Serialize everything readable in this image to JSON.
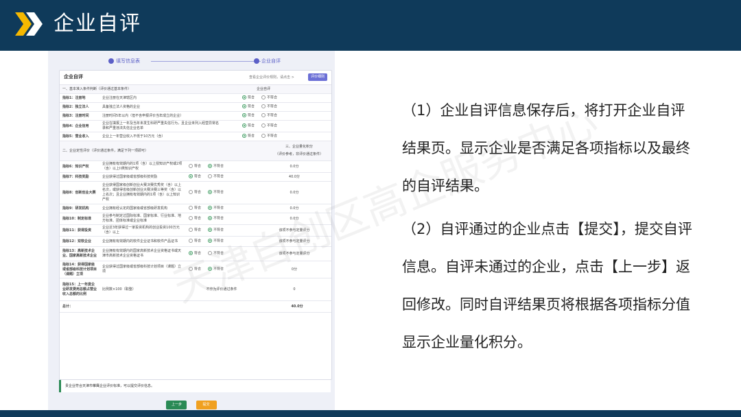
{
  "header": {
    "title": "企业自评"
  },
  "stepper": {
    "step1": "填写信息表",
    "step2": "企业自评"
  },
  "card": {
    "title": "企业自评",
    "search_placeholder": "查看企业评价规则，请点击 >",
    "rule_button": "评价细则"
  },
  "section1": {
    "title": "一、基本准入条件判断（评价通过基本条件）",
    "col_header": "企业自评"
  },
  "basic_rows": [
    {
      "name": "指标1：注册地",
      "desc": "企业注册在天津辖区内",
      "opt_yes": "符合",
      "opt_no": "不符合"
    },
    {
      "name": "指标2：独立法人",
      "desc": "具备独立法人资格的企业",
      "opt_yes": "符合",
      "opt_no": "不符合"
    },
    {
      "name": "指标3：注册时间",
      "desc": "注册时间5年以内（但不含申报评价当年成立的企业）",
      "opt_yes": "符合",
      "opt_no": "不符合"
    },
    {
      "name": "指标4：企业信用",
      "desc": "企业在填报上一年及当年未发生科研严重失信行为，且企业未列入经营异常名录和严重违法失信企业名单",
      "opt_yes": "符合",
      "opt_no": "不符合"
    },
    {
      "name": "指标5：营业收入",
      "desc": "企业上一年营业收入不低于10万元（含）",
      "opt_yes": "符合",
      "opt_no": "不符合"
    }
  ],
  "section2": {
    "title": "二、企业定性评价（评价通过条件，满足下列一项即可）",
    "col_header_1": "三、企业量化积分",
    "col_header_2": "（评价参考，非评价通过条件）"
  },
  "quality_rows": [
    {
      "name": "指标6：知识产权",
      "desc": "企业拥有有效期内的1项（含）以上授知识产权或2项（含）以上II类知识产权",
      "opt_yes": "符合",
      "opt_no": "不符合",
      "selected": "no",
      "score": "0.0分"
    },
    {
      "name": "指标7：科技奖励",
      "desc": "企业获得过国家级或省部级科技奖励",
      "opt_yes": "符合",
      "opt_no": "不符合",
      "selected": "yes",
      "score": "40.0分"
    },
    {
      "name": "指标8：创新创业大赛",
      "desc": "企业获得国家级创新创业大赛决赛优秀奖（含）以上名次，或获得省级创新创业大赛决赛三等奖（含）以上名次；且企业拥有有效期内的1项（含）以上知识产权",
      "opt_yes": "符合",
      "opt_no": "不符合",
      "selected": "no",
      "score": "0.0分"
    },
    {
      "name": "指标9：研发机构",
      "desc": "企业拥有经认定的国家级或省部级研发机构",
      "opt_yes": "符合",
      "opt_no": "不符合",
      "selected": "no",
      "score": "0.0分"
    },
    {
      "name": "指标10：制定标准",
      "desc": "企业参与制定过国际标准、国家标准、行业标准、地方标准、团体标准或企业标准",
      "opt_yes": "符合",
      "opt_no": "不符合",
      "selected": "no",
      "score": "0.0分"
    },
    {
      "name": "指标11：获得投资",
      "desc": "企业近3年获得过一家投资机构的创业投资100万元（含）以上",
      "opt_yes": "符合",
      "opt_no": "不符合",
      "selected": "no",
      "score": "该项不参与定量评分"
    },
    {
      "name": "指标12：双软企业",
      "desc": "企业拥有有效期内的软件企业证书和软件产品证书",
      "opt_yes": "符合",
      "opt_no": "不符合",
      "selected": "no",
      "score": "该项不参与定量评分"
    },
    {
      "name": "指标13：高新技术企业、国家高新技术企业",
      "desc": "企业拥有有效期内的国家高新技术企业资格证书或天津市高新技术企业资格证书",
      "opt_yes": "符合",
      "opt_no": "不符合",
      "selected": "yes",
      "score": "该项不参与定量评分"
    },
    {
      "name": "指标14：获得国家级或省部级科技计划项目（课题）立项",
      "desc": "企业获得过国家级或省部级科技计划项目（课题）立项",
      "opt_yes": "符合",
      "opt_no": "不符合",
      "selected": "no",
      "score": "0分"
    },
    {
      "name": "指标15：上一年度企业研发费用总额占营业收入总额的比例",
      "desc": "比例数×100（取整）",
      "opt_text": "不作为评价通过条件",
      "score": "0"
    }
  ],
  "total": {
    "label": "总计：",
    "value": "40.0分"
  },
  "notice": "贵企业符合天津市雏鹰企业评价标准，可以提交评价信息。",
  "buttons": {
    "prev": "上一步",
    "submit": "提交"
  },
  "description": {
    "p1": "（1）企业自评信息保存后，将打开企业自评结果页。显示企业是否满足各项指标以及最终的自评结果。",
    "p2": "（2）自评通过的企业点击【提交】，提交自评信息。自评未通过的企业，点击【上一步】返回修改。同时自评结果页将根据各项指标分值显示企业量化积分。"
  },
  "watermark": "天津自创区高企服务中心",
  "colors": {
    "banner": "#0f3a5a",
    "accent": "#5b5fc7",
    "chevron": "#f5b800",
    "green": "#2a8a55",
    "orange": "#f0a020"
  }
}
